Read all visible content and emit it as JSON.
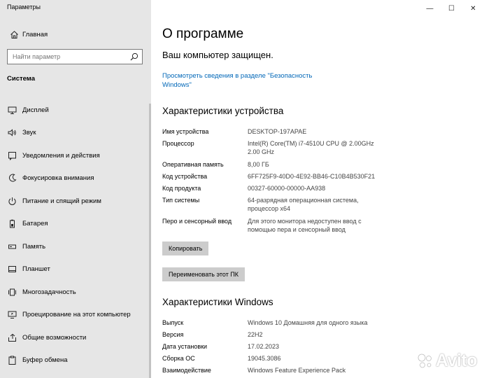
{
  "window": {
    "title": "Параметры",
    "controls": [
      "—",
      "☐",
      "✕"
    ]
  },
  "sidebar": {
    "home_label": "Главная",
    "search_placeholder": "Найти параметр",
    "section_label": "Система",
    "items": [
      {
        "label": "Дисплей",
        "icon": "display-icon"
      },
      {
        "label": "Звук",
        "icon": "sound-icon"
      },
      {
        "label": "Уведомления и действия",
        "icon": "notifications-icon"
      },
      {
        "label": "Фокусировка внимания",
        "icon": "focus-assist-icon"
      },
      {
        "label": "Питание и спящий режим",
        "icon": "power-icon"
      },
      {
        "label": "Батарея",
        "icon": "battery-icon"
      },
      {
        "label": "Память",
        "icon": "storage-icon"
      },
      {
        "label": "Планшет",
        "icon": "tablet-icon"
      },
      {
        "label": "Многозадачность",
        "icon": "multitasking-icon"
      },
      {
        "label": "Проецирование на этот компьютер",
        "icon": "projecting-icon"
      },
      {
        "label": "Общие возможности",
        "icon": "shared-experiences-icon"
      },
      {
        "label": "Буфер обмена",
        "icon": "clipboard-icon"
      },
      {
        "label": "",
        "icon": "remote-desktop-icon"
      }
    ]
  },
  "main": {
    "title": "О программе",
    "protected_text": "Ваш компьютер защищен.",
    "security_link_line1": "Просмотреть сведения в разделе \"Безопасность",
    "security_link_line2": "Windows\"",
    "device_specs_heading": "Характеристики устройства",
    "device_specs": [
      {
        "key": "Имя устройства",
        "value": "DESKTOP-197APAE"
      },
      {
        "key": "Процессор",
        "value": "Intel(R) Core(TM) i7-4510U CPU @ 2.00GHz 2.00 GHz"
      },
      {
        "key": "Оперативная память",
        "value": "8,00 ГБ"
      },
      {
        "key": "Код устройства",
        "value": "6FF725F9-40D0-4E92-BB46-C10B4B530F21"
      },
      {
        "key": "Код продукта",
        "value": "00327-60000-00000-AA938"
      },
      {
        "key": "Тип системы",
        "value": "64-разрядная операционная система, процессор x64"
      },
      {
        "key": "Перо и сенсорный ввод",
        "value": "Для этого монитора недоступен ввод с помощью пера и сенсорный ввод"
      }
    ],
    "copy_button": "Копировать",
    "rename_button": "Переименовать этот ПК",
    "windows_specs_heading": "Характеристики Windows",
    "windows_specs": [
      {
        "key": "Выпуск",
        "value": "Windows 10 Домашняя для одного языка"
      },
      {
        "key": "Версия",
        "value": "22H2"
      },
      {
        "key": "Дата установки",
        "value": "17.02.2023"
      },
      {
        "key": "Сборка ОС",
        "value": "19045.3086"
      },
      {
        "key": "Взаимодействие",
        "value": "Windows Feature Experience Pack"
      }
    ]
  },
  "watermark": {
    "text": "Avito"
  }
}
